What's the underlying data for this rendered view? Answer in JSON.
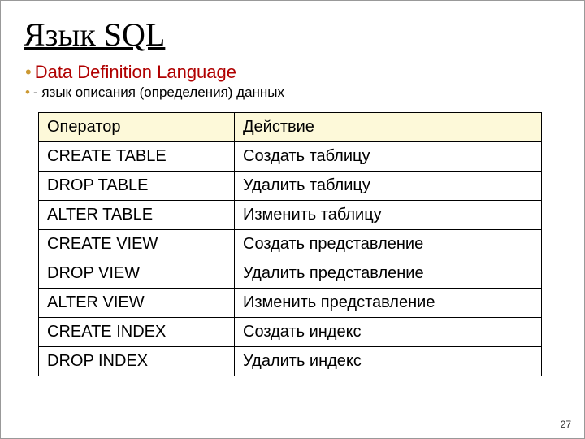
{
  "title": "Язык SQL",
  "subtitle_main": "Data Definition Language",
  "subtitle_sub": "- язык описания (определения) данных",
  "table": {
    "headers": {
      "col1": "Оператор",
      "col2": "Действие"
    },
    "rows": [
      {
        "op": "CREATE TABLE",
        "act": "Создать таблицу"
      },
      {
        "op": "DROP TABLE",
        "act": "Удалить таблицу"
      },
      {
        "op": "ALTER TABLE",
        "act": "Изменить таблицу"
      },
      {
        "op": "CREATE VIEW",
        "act": "Создать представление"
      },
      {
        "op": "DROP VIEW",
        "act": "Удалить представление"
      },
      {
        "op": "ALTER VIEW",
        "act": "Изменить представление"
      },
      {
        "op": "CREATE INDEX",
        "act": "Создать индекс"
      },
      {
        "op": "DROP INDEX",
        "act": "Удалить индекс"
      }
    ]
  },
  "page_number": "27"
}
